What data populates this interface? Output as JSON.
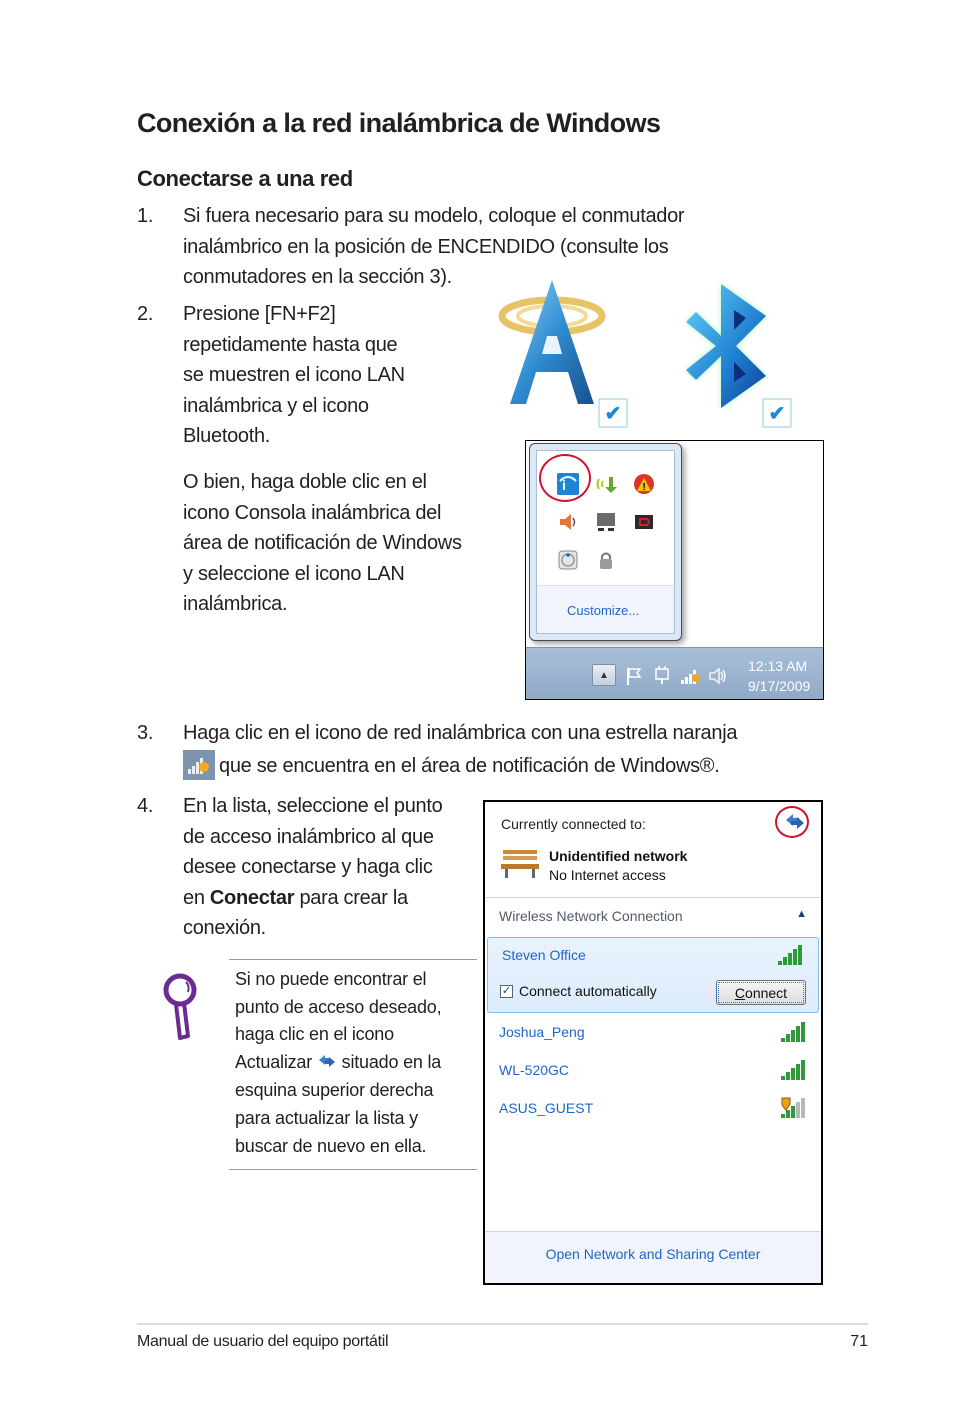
{
  "page": {
    "title": "Conexión a la red inalámbrica de Windows",
    "subtitle": "Conectarse a una red"
  },
  "steps": [
    {
      "number": "1.",
      "lines": [
        "Si fuera necesario para su modelo, coloque el conmutador",
        "inalámbrico en la posición de ENCENDIDO (consulte los",
        "conmutadores en la sección 3)."
      ]
    },
    {
      "number": "2.",
      "lines": [
        "Presione [FN+F2]",
        "repetidamente hasta que",
        "se muestren el icono LAN",
        "inalámbrica y el icono",
        "Bluetooth."
      ],
      "extra_lines": [
        "O bien, haga doble clic en el",
        "icono Consola inalámbrica del",
        "área de notificación de Windows",
        "y seleccione el icono LAN",
        "inalámbrica."
      ]
    },
    {
      "number": "3.",
      "line1": "Haga clic en el icono de red inalámbrica con una estrella naranja",
      "line2": "que se encuentra en el área de notificación de Windows®."
    },
    {
      "number": "4.",
      "line1": "En la lista, seleccione el punto",
      "line2": "de acceso inalámbrico al que",
      "line3": "desee conectarse y haga clic",
      "line4_pre": "en ",
      "line4_bold": "Conectar",
      "line4_post": " para crear la",
      "line5": "conexión."
    }
  ],
  "toggle_icons": {
    "wlan": {
      "icon": "wireless-lan-tower-icon",
      "checked": true
    },
    "bluetooth": {
      "icon": "bluetooth-icon",
      "checked": true
    },
    "check_glyph": "✔"
  },
  "tray_screenshot": {
    "icons": [
      "wireless-console-icon",
      "network-download-icon",
      "warning-alert-icon",
      "speaker-icon",
      "display-icon",
      "media-icon",
      "disk-icon",
      "lock-icon"
    ],
    "customize_label": "Customize...",
    "taskbar_icons": [
      "show-hidden-icons-button",
      "flag-icon",
      "power-plug-icon",
      "wifi-signal-icon",
      "volume-icon"
    ],
    "up_arrow": "▲",
    "clock_time": "12:13 AM",
    "clock_date": "9/17/2009"
  },
  "network_flyout": {
    "currently_connected_label": "Currently connected to:",
    "current_network_name": "Unidentified network",
    "current_network_status": "No Internet access",
    "section_label": "Wireless Network Connection",
    "collapse_glyph": "▲",
    "networks": [
      {
        "name": "Steven Office",
        "signal_bars": 5,
        "secured": false,
        "selected": true
      },
      {
        "name": "Joshua_Peng",
        "signal_bars": 5,
        "secured": false,
        "selected": false
      },
      {
        "name": "WL-520GC",
        "signal_bars": 5,
        "secured": false,
        "selected": false
      },
      {
        "name": "ASUS_GUEST",
        "signal_bars": 3,
        "secured": true,
        "selected": false
      }
    ],
    "connect_auto_label": "Connect automatically",
    "connect_auto_checked": true,
    "check_glyph": "✓",
    "connect_button_label_first": "C",
    "connect_button_label_rest": "onnect",
    "footer_link": "Open Network and Sharing Center"
  },
  "note": {
    "line1": "Si no puede encontrar el",
    "line2": "punto de acceso deseado,",
    "line3": "haga clic en el icono",
    "line4_pre": "Actualizar ",
    "line4_post": " situado en la",
    "line5": "esquina superior derecha",
    "line6": "para actualizar la lista y",
    "line7": "buscar de nuevo en ella."
  },
  "footer": {
    "manual_title": "Manual de usuario del equipo portátil",
    "page_number": "71"
  },
  "colors": {
    "highlight_red": "#d3122d",
    "link_blue": "#1e66c9",
    "signal_green": "#2e9a3a",
    "note_purple": "#6a2c91"
  }
}
